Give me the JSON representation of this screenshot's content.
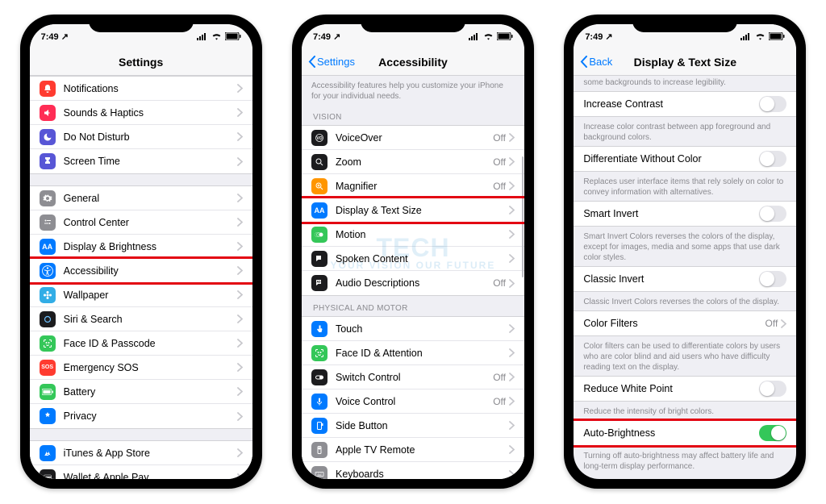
{
  "status": {
    "time": "7:49",
    "location_arrow": "↗"
  },
  "phone1": {
    "title": "Settings",
    "groups": [
      [
        {
          "icon": "bell",
          "bg": "bg-red",
          "label": "Notifications"
        },
        {
          "icon": "speaker",
          "bg": "bg-pink",
          "label": "Sounds & Haptics"
        },
        {
          "icon": "moon",
          "bg": "bg-purple",
          "label": "Do Not Disturb"
        },
        {
          "icon": "hourglass",
          "bg": "bg-purple",
          "label": "Screen Time"
        }
      ],
      [
        {
          "icon": "gear",
          "bg": "bg-gray",
          "label": "General"
        },
        {
          "icon": "sliders",
          "bg": "bg-gray",
          "label": "Control Center"
        },
        {
          "icon": "aa",
          "bg": "bg-blue",
          "label": "Display & Brightness"
        },
        {
          "icon": "access",
          "bg": "bg-blue",
          "label": "Accessibility",
          "highlight": true
        },
        {
          "icon": "flower",
          "bg": "bg-teal",
          "label": "Wallpaper"
        },
        {
          "icon": "siri",
          "bg": "bg-black",
          "label": "Siri & Search"
        },
        {
          "icon": "faceid",
          "bg": "bg-green",
          "label": "Face ID & Passcode"
        },
        {
          "icon": "sos",
          "bg": "bg-sos",
          "label": "Emergency SOS"
        },
        {
          "icon": "battery",
          "bg": "bg-green",
          "label": "Battery"
        },
        {
          "icon": "hand",
          "bg": "bg-blue",
          "label": "Privacy"
        }
      ],
      [
        {
          "icon": "appstore",
          "bg": "bg-blue",
          "label": "iTunes & App Store"
        },
        {
          "icon": "wallet",
          "bg": "bg-black",
          "label": "Wallet & Apple Pay"
        }
      ]
    ]
  },
  "phone2": {
    "back": "Settings",
    "title": "Accessibility",
    "desc": "Accessibility features help you customize your iPhone for your individual needs.",
    "section1": "VISION",
    "group1": [
      {
        "icon": "voiceover",
        "bg": "bg-black",
        "label": "VoiceOver",
        "value": "Off"
      },
      {
        "icon": "zoom",
        "bg": "bg-black",
        "label": "Zoom",
        "value": "Off"
      },
      {
        "icon": "magnifier",
        "bg": "bg-orange",
        "label": "Magnifier",
        "value": "Off"
      },
      {
        "icon": "aa",
        "bg": "bg-blue",
        "label": "Display & Text Size",
        "highlight": true
      },
      {
        "icon": "motion",
        "bg": "bg-green",
        "label": "Motion"
      },
      {
        "icon": "spoken",
        "bg": "bg-black",
        "label": "Spoken Content"
      },
      {
        "icon": "audio",
        "bg": "bg-black",
        "label": "Audio Descriptions",
        "value": "Off"
      }
    ],
    "section2": "PHYSICAL AND MOTOR",
    "group2": [
      {
        "icon": "touch",
        "bg": "bg-blue",
        "label": "Touch"
      },
      {
        "icon": "faceid",
        "bg": "bg-green",
        "label": "Face ID & Attention"
      },
      {
        "icon": "switch",
        "bg": "bg-black",
        "label": "Switch Control",
        "value": "Off"
      },
      {
        "icon": "voice",
        "bg": "bg-blue",
        "label": "Voice Control",
        "value": "Off"
      },
      {
        "icon": "side",
        "bg": "bg-blue",
        "label": "Side Button"
      },
      {
        "icon": "remote",
        "bg": "bg-gray",
        "label": "Apple TV Remote"
      },
      {
        "icon": "keyboard",
        "bg": "bg-gray",
        "label": "Keyboards"
      }
    ]
  },
  "phone3": {
    "back": "Back",
    "title": "Display & Text Size",
    "cut": "some backgrounds to increase legibility.",
    "items": [
      {
        "label": "Increase Contrast",
        "toggle": false,
        "desc": "Increase color contrast between app foreground and background colors."
      },
      {
        "label": "Differentiate Without Color",
        "toggle": false,
        "desc": "Replaces user interface items that rely solely on color to convey information with alternatives."
      },
      {
        "label": "Smart Invert",
        "toggle": false,
        "desc": "Smart Invert Colors reverses the colors of the display, except for images, media and some apps that use dark color styles."
      },
      {
        "label": "Classic Invert",
        "toggle": false,
        "desc": "Classic Invert Colors reverses the colors of the display."
      },
      {
        "label": "Color Filters",
        "value": "Off",
        "desc": "Color filters can be used to differentiate colors by users who are color blind and aid users who have difficulty reading text on the display."
      },
      {
        "label": "Reduce White Point",
        "toggle": false,
        "desc": "Reduce the intensity of bright colors."
      },
      {
        "label": "Auto-Brightness",
        "toggle": true,
        "highlight": true,
        "desc": "Turning off auto-brightness may affect battery life and long-term display performance."
      }
    ]
  },
  "watermark": {
    "main": "TECH",
    "sub": "YOUR VISION\nOUR FUTURE"
  }
}
